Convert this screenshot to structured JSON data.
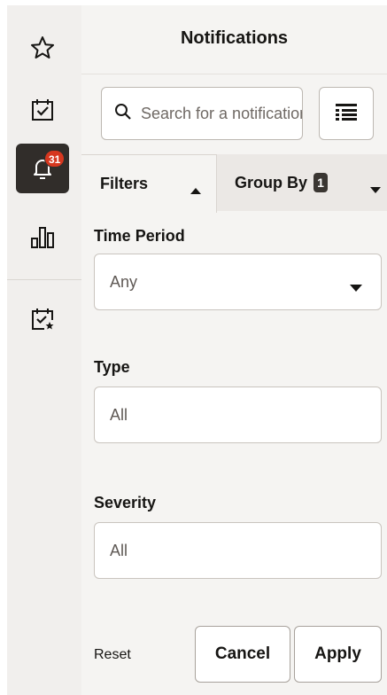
{
  "rail": {
    "items": [
      {
        "name": "favorites",
        "icon": "star-icon"
      },
      {
        "name": "tasks",
        "icon": "calendar-check-icon"
      },
      {
        "name": "notifications",
        "icon": "bell-icon",
        "badge": "31",
        "active": true
      },
      {
        "name": "analytics",
        "icon": "bar-chart-icon"
      },
      {
        "name": "scheduled",
        "icon": "calendar-star-icon"
      }
    ]
  },
  "panel": {
    "title": "Notifications",
    "search": {
      "placeholder": "Search for a notification"
    },
    "tabs": {
      "filters_label": "Filters",
      "groupby_label": "Group By",
      "groupby_count": "1"
    },
    "fields": {
      "time_period": {
        "label": "Time Period",
        "value": "Any"
      },
      "type": {
        "label": "Type",
        "value": "All"
      },
      "severity": {
        "label": "Severity",
        "value": "All"
      }
    },
    "footer": {
      "reset_label": "Reset",
      "cancel_label": "Cancel",
      "apply_label": "Apply"
    }
  },
  "colors": {
    "active_rail": "#312d2a",
    "badge": "#d6371f"
  }
}
